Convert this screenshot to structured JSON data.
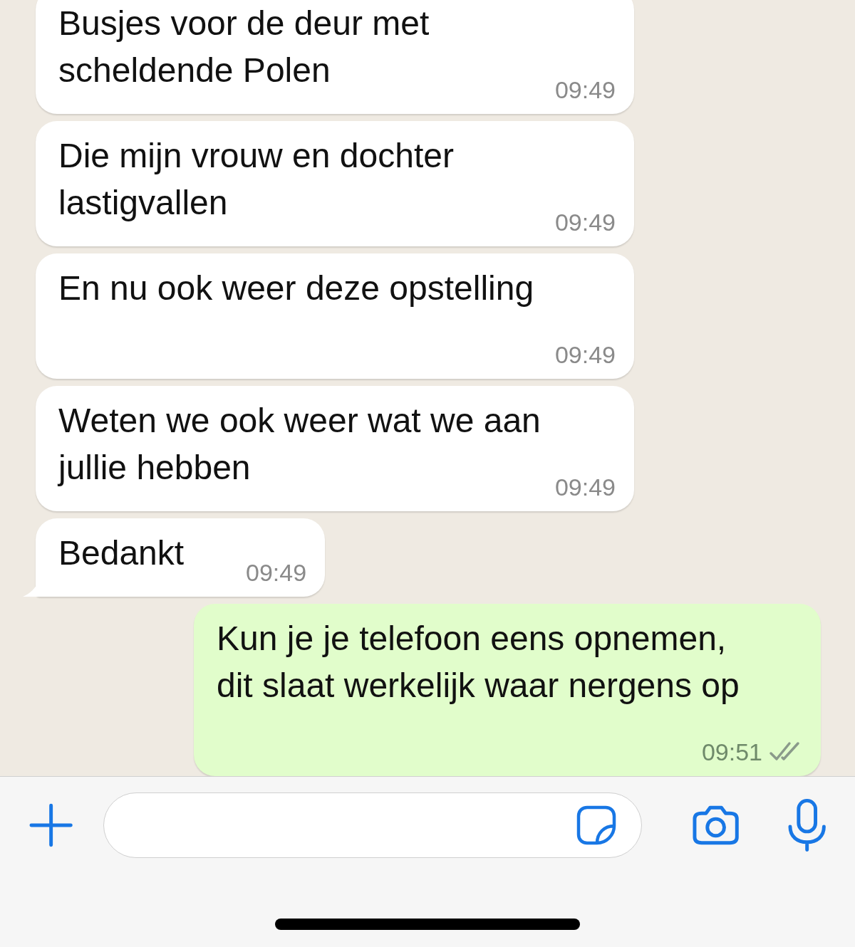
{
  "messages": [
    {
      "kind": "incoming",
      "text": "Busjes voor de deur met scheldende Polen",
      "time": "09:49",
      "tail": false
    },
    {
      "kind": "incoming",
      "text": "Die mijn vrouw en dochter lastigvallen",
      "time": "09:49",
      "tail": false
    },
    {
      "kind": "incoming",
      "text": "En nu ook weer deze opstelling",
      "time": "09:49",
      "tail": false
    },
    {
      "kind": "incoming",
      "text": "Weten we ook weer wat we aan jullie hebben",
      "time": "09:49",
      "tail": false
    },
    {
      "kind": "incoming",
      "text": "Bedankt",
      "time": "09:49",
      "tail": true
    },
    {
      "kind": "outgoing",
      "text": "Kun je je telefoon eens opnemen, dit slaat werkelijk waar nergens op",
      "time": "09:51",
      "tail": false,
      "read": false
    }
  ]
}
